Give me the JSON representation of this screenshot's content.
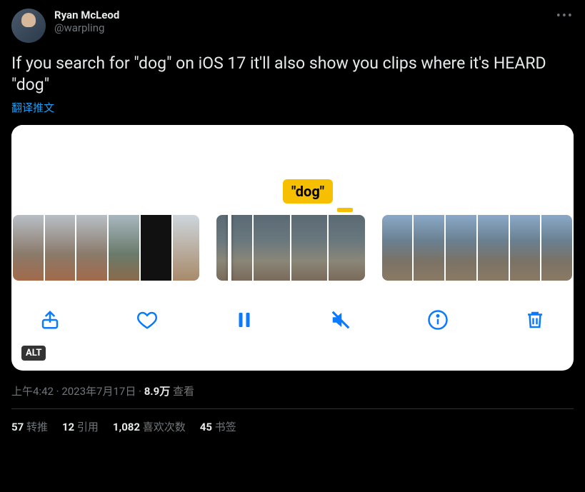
{
  "author": {
    "display_name": "Ryan McLeod",
    "handle": "@warpling"
  },
  "body_text": "If you search for \"dog\" on iOS 17 it'll also show you clips where it's HEARD \"dog\"",
  "translate_label": "翻译推文",
  "media": {
    "caption_pill": "\"dog\"",
    "alt_badge": "ALT"
  },
  "meta": {
    "time": "上午4:42",
    "sep": " · ",
    "date": "2023年7月17日",
    "views_count": "8.9万",
    "views_label": " 查看"
  },
  "stats": {
    "retweets_count": "57",
    "retweets_label": " 转推",
    "quotes_count": "12",
    "quotes_label": " 引用",
    "likes_count": "1,082",
    "likes_label": " 喜欢次数",
    "bookmarks_count": "45",
    "bookmarks_label": " 书签"
  }
}
